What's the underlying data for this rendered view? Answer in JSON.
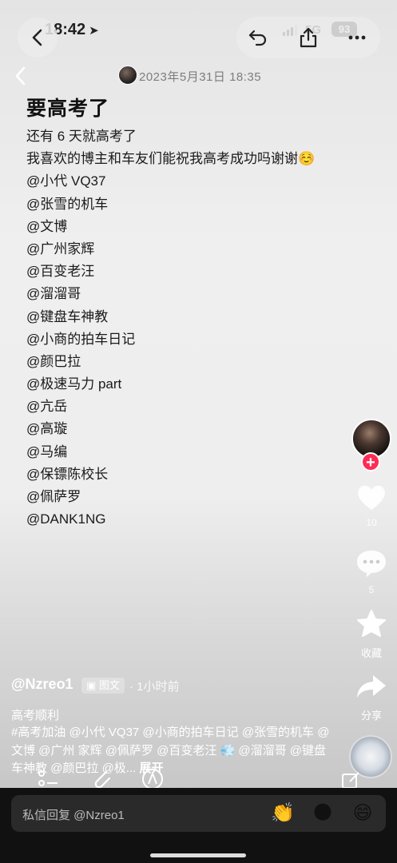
{
  "status_bar": {
    "time": "18:42",
    "network": "5G",
    "battery": "93"
  },
  "header": {
    "ghost_date": "2023年5月31日 18:35"
  },
  "post": {
    "title": "要高考了",
    "lines": [
      "还有 6 天就高考了",
      "我喜欢的博主和车友们能祝我高考成功吗谢谢☺️",
      "@小代 VQ37",
      "@张雪的机车",
      "@文博",
      "@广州家辉",
      "@百变老汪",
      "@溜溜哥",
      "@键盘车神教",
      "@小商的拍车日记",
      "@颜巴拉",
      "@极速马力 part",
      "@亢岳",
      "@高璇",
      "@马编",
      "@保镖陈校长",
      "@佩萨罗",
      "@DANK1NG"
    ]
  },
  "rail": {
    "like_count": "10",
    "comment_count": "5",
    "favorite_label": "收藏",
    "share_label": "分享"
  },
  "info": {
    "author": "@Nzreo1",
    "type_tag": "图文",
    "time_ago": "· 1小时前",
    "caption_title": "高考顺利",
    "caption_text": "#高考加油 @小代 VQ37 @小商的拍车日记 @张雪的机车 @文博 @广州 家辉 @佩萨罗 @百变老汪 💨 @溜溜哥 @键盘车神教 @颜巴拉 @极...",
    "expand_label": "展开"
  },
  "reply": {
    "placeholder": "私信回复 @Nzreo1",
    "emojis": [
      "👏",
      "🌑",
      "😄"
    ]
  },
  "icons": {
    "back": "chevron-left-icon",
    "undo": "undo-icon",
    "share": "share-upload-icon",
    "more": "more-dots-icon"
  }
}
